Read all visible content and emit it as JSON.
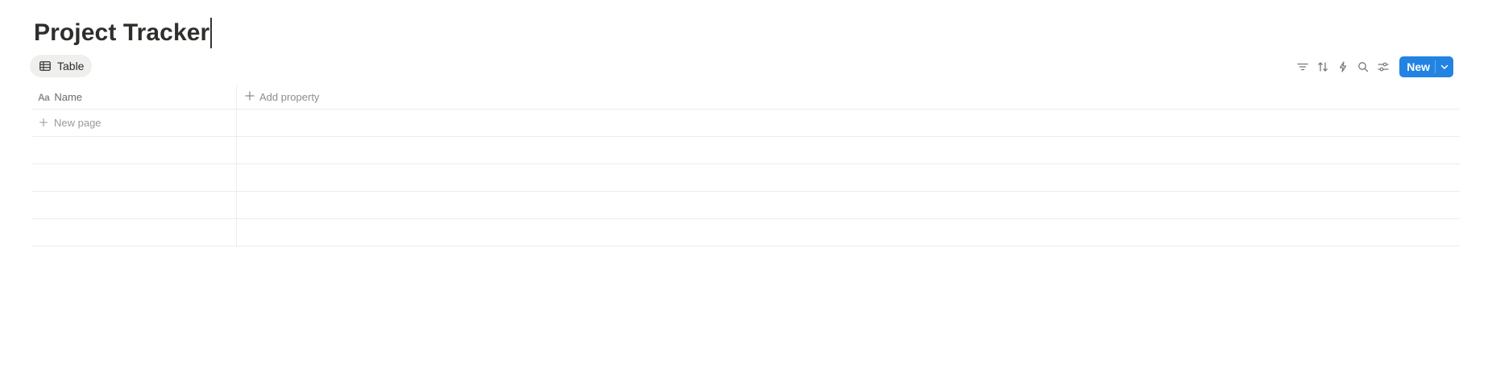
{
  "page": {
    "title": "Project Tracker"
  },
  "view_tab": {
    "label": "Table",
    "icon": "table-icon"
  },
  "toolbar": {
    "icons": [
      "filter-icon",
      "sort-icon",
      "automation-bolt-icon",
      "search-icon",
      "settings-sliders-icon"
    ],
    "new_label": "New",
    "accent": "#2383e2"
  },
  "table": {
    "columns": [
      {
        "label": "Name",
        "icon": "text-aa-icon"
      }
    ],
    "add_property_label": "Add property",
    "new_page_label": "New page",
    "empty_rows": 4
  }
}
